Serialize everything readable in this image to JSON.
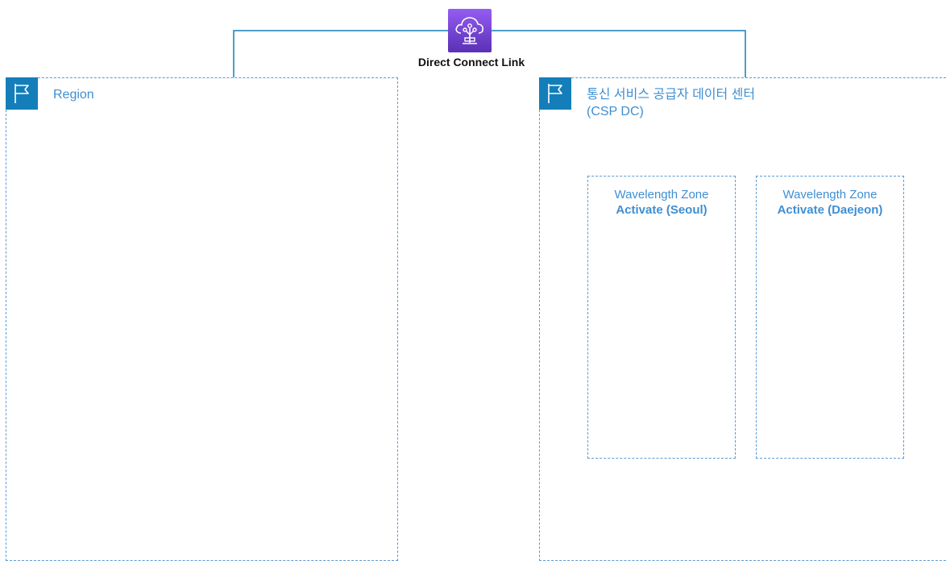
{
  "diagram": {
    "direct_connect": {
      "label": "Direct Connect Link",
      "icon": "direct-connect-icon",
      "icon_color": "#7b3fe4"
    },
    "groups": [
      {
        "id": "region",
        "label": "Region",
        "icon": "flag-icon"
      },
      {
        "id": "csp-dc",
        "label_line1": "통신 서비스 공급자 데이터 센터",
        "label_line2": "(CSP DC)",
        "icon": "flag-icon"
      }
    ],
    "zones": [
      {
        "title": "Wavelength Zone",
        "name": "Activate (Seoul)"
      },
      {
        "title": "Wavelength Zone",
        "name": "Activate (Daejeon)"
      }
    ],
    "colors": {
      "group_border": "#5b9bd5",
      "group_label": "#3f8fd2",
      "flag_bg": "#147eba",
      "connector": "#147eba"
    }
  }
}
